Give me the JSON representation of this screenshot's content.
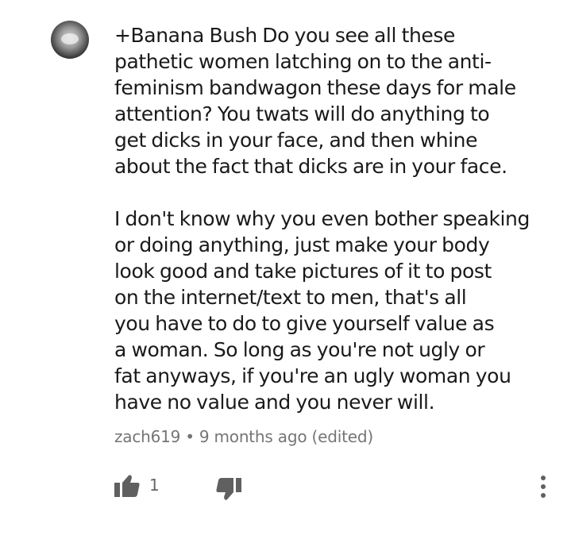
{
  "comment": {
    "paragraph1_lines": [
      "+Banana Bush Do you see all these",
      "pathetic women latching on to the anti-",
      "feminism bandwagon these days for male",
      "attention? You twats will do anything to",
      "get dicks in your face, and then whine",
      "about the fact that dicks are in your face."
    ],
    "paragraph2_lines": [
      "I don't know why you even bother speaking",
      "or doing anything, just make your body",
      "look good and take pictures of it to post",
      "on the internet/text to men, that's all",
      "you have to do to give yourself value as",
      "a woman. So long as you're not ugly or",
      "fat anyways, if you're an ugly woman you",
      "have no value and you never will."
    ]
  },
  "meta": {
    "author": "zach619",
    "separator": "•",
    "time": "9 months ago",
    "edited": "(edited)"
  },
  "actions": {
    "like_count": "1",
    "like_icon": "thumbs-up-icon",
    "dislike_icon": "thumbs-down-icon",
    "more_icon": "more-vertical-icon"
  },
  "colors": {
    "text": "#1a1a1a",
    "meta_text": "#757575",
    "icon": "#606060"
  }
}
